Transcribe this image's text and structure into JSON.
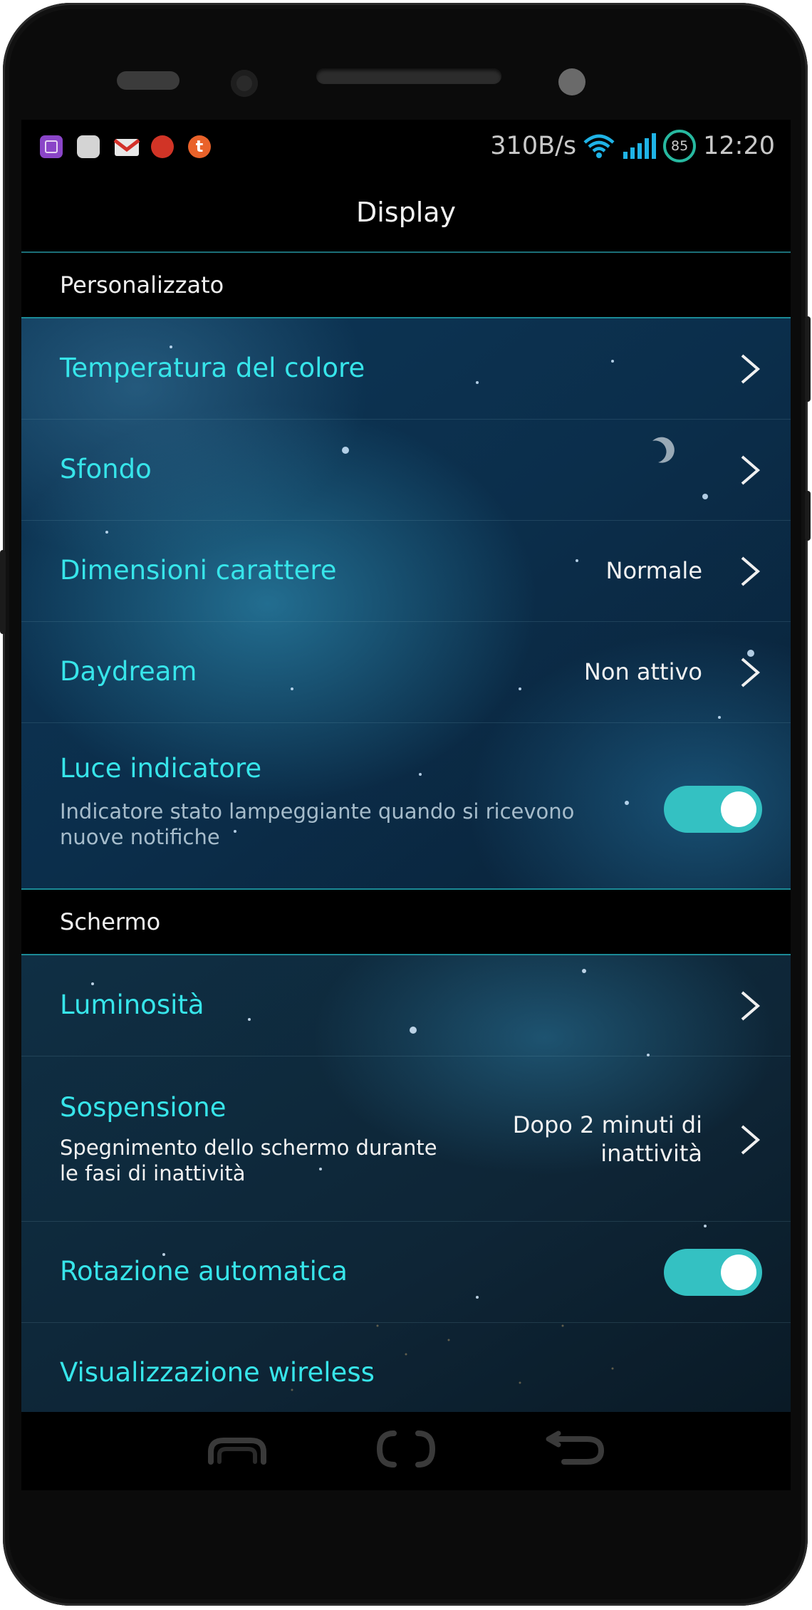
{
  "status_bar": {
    "notification_icons": [
      "gallery-icon",
      "message-icon",
      "gmail-icon",
      "browser-icon",
      "tumblr-icon"
    ],
    "net_speed": "310B/s",
    "battery_level": "85",
    "time": "12:20"
  },
  "header": {
    "title": "Display"
  },
  "sections": {
    "custom": {
      "label": "Personalizzato",
      "items": [
        {
          "title": "Temperatura del colore"
        },
        {
          "title": "Sfondo"
        },
        {
          "title": "Dimensioni carattere",
          "value": "Normale"
        },
        {
          "title": "Daydream",
          "value": "Non attivo"
        },
        {
          "title": "Luce indicatore",
          "subtitle": "Indicatore stato lampeggiante quando si ricevono nuove notifiche",
          "toggle_on": true
        }
      ]
    },
    "screen": {
      "label": "Schermo",
      "items": [
        {
          "title": "Luminosità"
        },
        {
          "title": "Sospensione",
          "subtitle": "Spegnimento dello schermo durante le fasi di inattività",
          "value": "Dopo 2 minuti di inattività"
        },
        {
          "title": "Rotazione automatica",
          "toggle_on": true
        },
        {
          "title": "Visualizzazione wireless"
        }
      ]
    }
  },
  "nav_bar": {
    "icons": [
      "recent-apps-icon",
      "home-icon",
      "back-icon"
    ]
  },
  "colors": {
    "accent_text": "#37e5ea",
    "toggle_on": "#34c1c2",
    "divider": "#1b8a96",
    "battery_ring": "#27b9a0"
  }
}
